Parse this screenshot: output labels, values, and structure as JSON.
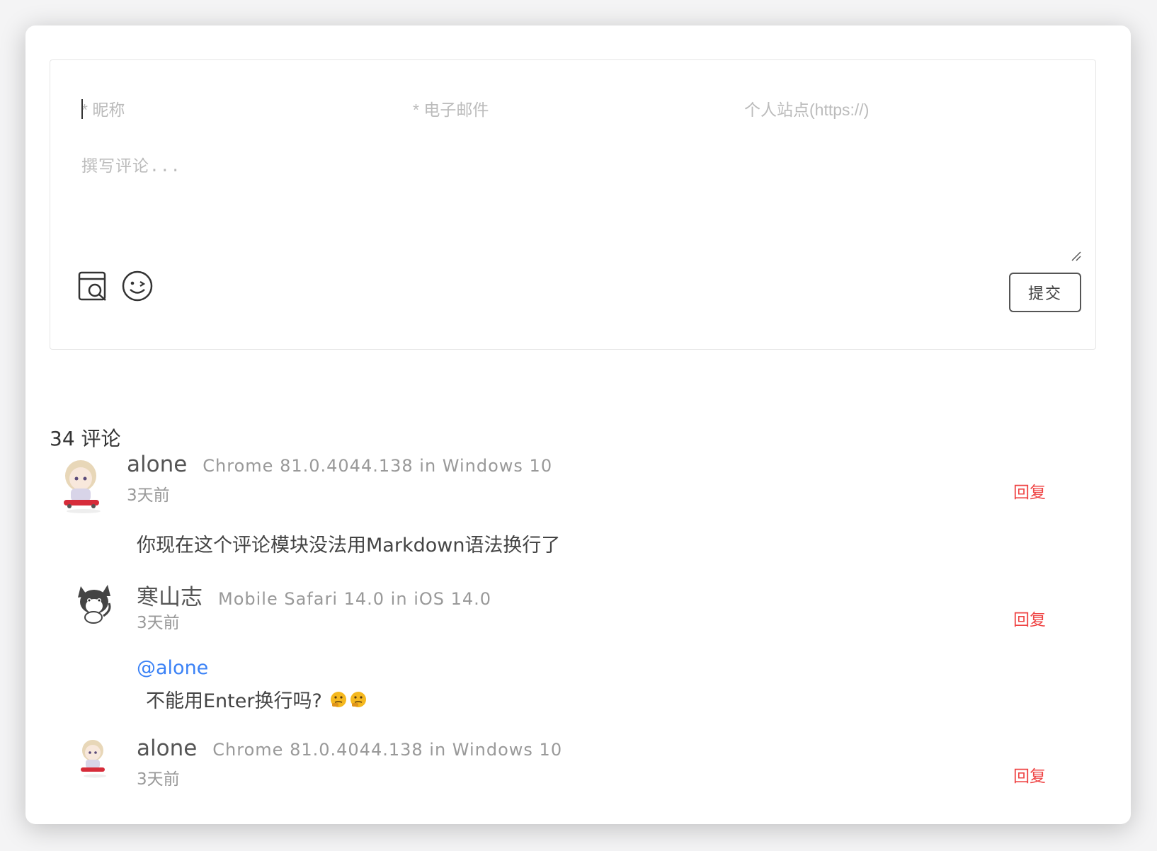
{
  "form": {
    "nick_placeholder": "* 昵称",
    "email_placeholder": "* 电子邮件",
    "site_placeholder": "个人站点(https://)",
    "comment_placeholder": "撰写评论...",
    "submit_label": "提交"
  },
  "comment_count": "34 评论",
  "comments": [
    {
      "nick": "alone",
      "ua": "Chrome 81.0.4044.138 in Windows 10",
      "time": "3天前",
      "reply": "回复",
      "content": "你现在这个评论模块没法用Markdown语法换行了"
    },
    {
      "nick": "寒山志",
      "ua": "Mobile Safari 14.0 in iOS 14.0",
      "time": "3天前",
      "reply": "回复",
      "mention": "@alone",
      "content": "不能用Enter换行吗?"
    },
    {
      "nick": "alone",
      "ua": "Chrome 81.0.4044.138 in Windows 10",
      "time": "3天前",
      "reply": "回复"
    }
  ]
}
